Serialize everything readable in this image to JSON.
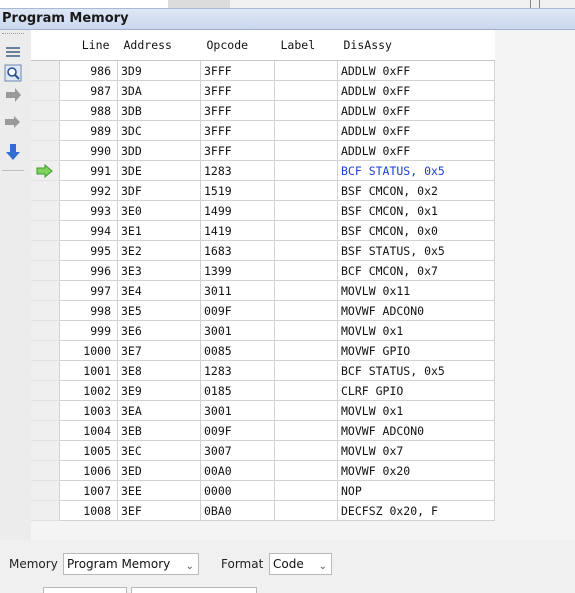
{
  "window": {
    "title": "Program Memory"
  },
  "columns": [
    "Line",
    "Address",
    "Opcode",
    "Label",
    "DisAssy"
  ],
  "rows": [
    {
      "line": "986",
      "address": "3D9",
      "opcode": "3FFF",
      "label": "",
      "disassy": "ADDLW 0xFF",
      "current": false
    },
    {
      "line": "987",
      "address": "3DA",
      "opcode": "3FFF",
      "label": "",
      "disassy": "ADDLW 0xFF",
      "current": false
    },
    {
      "line": "988",
      "address": "3DB",
      "opcode": "3FFF",
      "label": "",
      "disassy": "ADDLW 0xFF",
      "current": false
    },
    {
      "line": "989",
      "address": "3DC",
      "opcode": "3FFF",
      "label": "",
      "disassy": "ADDLW 0xFF",
      "current": false
    },
    {
      "line": "990",
      "address": "3DD",
      "opcode": "3FFF",
      "label": "",
      "disassy": "ADDLW 0xFF",
      "current": false
    },
    {
      "line": "991",
      "address": "3DE",
      "opcode": "1283",
      "label": "",
      "disassy": "BCF STATUS, 0x5",
      "current": true
    },
    {
      "line": "992",
      "address": "3DF",
      "opcode": "1519",
      "label": "",
      "disassy": "BSF CMCON, 0x2",
      "current": false
    },
    {
      "line": "993",
      "address": "3E0",
      "opcode": "1499",
      "label": "",
      "disassy": "BSF CMCON, 0x1",
      "current": false
    },
    {
      "line": "994",
      "address": "3E1",
      "opcode": "1419",
      "label": "",
      "disassy": "BSF CMCON, 0x0",
      "current": false
    },
    {
      "line": "995",
      "address": "3E2",
      "opcode": "1683",
      "label": "",
      "disassy": "BSF STATUS, 0x5",
      "current": false
    },
    {
      "line": "996",
      "address": "3E3",
      "opcode": "1399",
      "label": "",
      "disassy": "BCF CMCON, 0x7",
      "current": false
    },
    {
      "line": "997",
      "address": "3E4",
      "opcode": "3011",
      "label": "",
      "disassy": "MOVLW 0x11",
      "current": false
    },
    {
      "line": "998",
      "address": "3E5",
      "opcode": "009F",
      "label": "",
      "disassy": "MOVWF ADCON0",
      "current": false
    },
    {
      "line": "999",
      "address": "3E6",
      "opcode": "3001",
      "label": "",
      "disassy": "MOVLW 0x1",
      "current": false
    },
    {
      "line": "1000",
      "address": "3E7",
      "opcode": "0085",
      "label": "",
      "disassy": "MOVWF GPIO",
      "current": false
    },
    {
      "line": "1001",
      "address": "3E8",
      "opcode": "1283",
      "label": "",
      "disassy": "BCF STATUS, 0x5",
      "current": false
    },
    {
      "line": "1002",
      "address": "3E9",
      "opcode": "0185",
      "label": "",
      "disassy": "CLRF GPIO",
      "current": false
    },
    {
      "line": "1003",
      "address": "3EA",
      "opcode": "3001",
      "label": "",
      "disassy": "MOVLW 0x1",
      "current": false
    },
    {
      "line": "1004",
      "address": "3EB",
      "opcode": "009F",
      "label": "",
      "disassy": "MOVWF ADCON0",
      "current": false
    },
    {
      "line": "1005",
      "address": "3EC",
      "opcode": "3007",
      "label": "",
      "disassy": "MOVLW 0x7",
      "current": false
    },
    {
      "line": "1006",
      "address": "3ED",
      "opcode": "00A0",
      "label": "",
      "disassy": "MOVWF 0x20",
      "current": false
    },
    {
      "line": "1007",
      "address": "3EE",
      "opcode": "0000",
      "label": "",
      "disassy": "NOP",
      "current": false
    },
    {
      "line": "1008",
      "address": "3EF",
      "opcode": "0BA0",
      "label": "",
      "disassy": "DECFSZ 0x20, F",
      "current": false
    }
  ],
  "bottom": {
    "memory_label": "Memory",
    "memory_value": "Program Memory",
    "format_label": "Format",
    "format_value": "Code"
  },
  "colors": {
    "current_row_text": "#1a3fd6",
    "title_bg": "#c9d7ee",
    "pc_arrow": "#3a9a2a",
    "nav_icon": "#2f6fd1"
  },
  "icons": [
    "menu-icon",
    "find-icon",
    "step-into-icon",
    "step-over-icon",
    "run-to-icon",
    "pc-arrow-icon",
    "chevron-down-icon"
  ]
}
